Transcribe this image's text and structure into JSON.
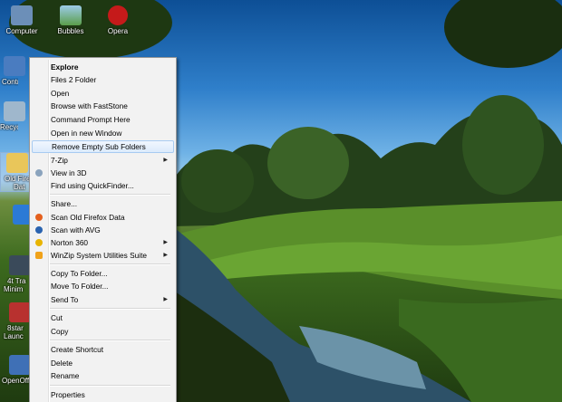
{
  "desktop_icons": [
    {
      "id": "computer",
      "label": "Computer",
      "icon": "computer-icon"
    },
    {
      "id": "bubbles",
      "label": "Bubbles",
      "icon": "image-icon"
    },
    {
      "id": "opera",
      "label": "Opera",
      "icon": "opera-icon"
    },
    {
      "id": "control",
      "label": "Contro",
      "icon": "control-panel-icon"
    },
    {
      "id": "recycle",
      "label": "Recyc",
      "icon": "recycle-bin-icon"
    },
    {
      "id": "oldfirefox",
      "label": "Old Fire",
      "label2": "Dat",
      "icon": "folder-icon"
    },
    {
      "id": "dropbox",
      "label": "",
      "icon": "dropbox-icon"
    },
    {
      "id": "4ttray",
      "label": "4t Tra",
      "label2": "Minim",
      "icon": "app-icon"
    },
    {
      "id": "8start",
      "label": "8star",
      "label2": "Launc",
      "icon": "app-icon"
    },
    {
      "id": "openoffice",
      "label": "OpenOff",
      "icon": "openoffice-icon"
    }
  ],
  "context_menu": {
    "items": [
      {
        "label": "Explore"
      },
      {
        "label": "Files 2 Folder"
      },
      {
        "label": "Open"
      },
      {
        "label": "Browse with FastStone"
      },
      {
        "label": "Command Prompt Here"
      },
      {
        "label": "Open in new Window"
      },
      {
        "label": "Remove Empty Sub Folders"
      },
      {
        "label": "7-Zip"
      },
      {
        "label": "View in 3D"
      },
      {
        "label": "Find using QuickFinder..."
      },
      {
        "label": "Share..."
      },
      {
        "label": "Scan Old Firefox Data"
      },
      {
        "label": "Scan with AVG"
      },
      {
        "label": "Norton 360"
      },
      {
        "label": "WinZip System Utilities Suite"
      },
      {
        "label": "Copy To Folder..."
      },
      {
        "label": "Move To Folder..."
      },
      {
        "label": "Send To"
      },
      {
        "label": "Cut"
      },
      {
        "label": "Copy"
      },
      {
        "label": "Create Shortcut"
      },
      {
        "label": "Delete"
      },
      {
        "label": "Rename"
      },
      {
        "label": "Properties"
      }
    ],
    "submenu_arrow": "▶"
  },
  "colors": {
    "menu_bg": "#f2f2f2",
    "menu_border": "#979797",
    "highlight": "#dcebfc"
  }
}
